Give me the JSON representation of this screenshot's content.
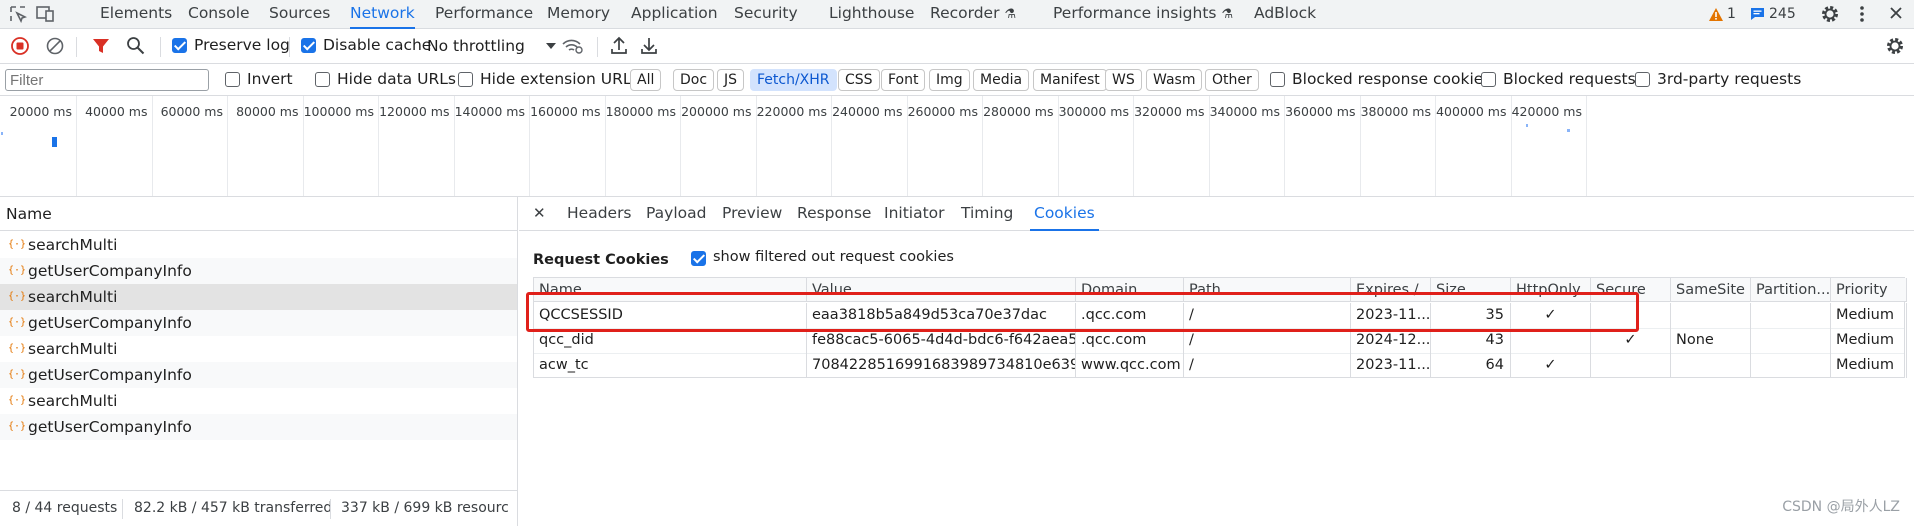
{
  "topbar": {
    "tabs": [
      "Elements",
      "Console",
      "Sources",
      "Network",
      "Performance",
      "Memory",
      "Application",
      "Security",
      "Lighthouse",
      "Recorder",
      "Performance insights",
      "AdBlock"
    ],
    "recorder_suffix": "⚗",
    "perf_insights_suffix": "⚗",
    "warning_count": "1",
    "message_count": "245"
  },
  "toolbar": {
    "preserve_log": "Preserve log",
    "disable_cache": "Disable cache",
    "throttling": "No throttling"
  },
  "filterbar": {
    "filter_placeholder": "Filter",
    "invert": "Invert",
    "hide_data_urls": "Hide data URLs",
    "hide_extension_urls": "Hide extension URLs",
    "types": [
      "All",
      "Doc",
      "JS",
      "Fetch/XHR",
      "CSS",
      "Font",
      "Img",
      "Media",
      "Manifest",
      "WS",
      "Wasm",
      "Other"
    ],
    "active_type": "Fetch/XHR",
    "blocked_response_cookies": "Blocked response cookies",
    "blocked_requests": "Blocked requests",
    "third_party": "3rd-party requests"
  },
  "overview": {
    "ticks": [
      "20000 ms",
      "40000 ms",
      "60000 ms",
      "80000 ms",
      "100000 ms",
      "120000 ms",
      "140000 ms",
      "160000 ms",
      "180000 ms",
      "200000 ms",
      "220000 ms",
      "240000 ms",
      "260000 ms",
      "280000 ms",
      "300000 ms",
      "320000 ms",
      "340000 ms",
      "360000 ms",
      "380000 ms",
      "400000 ms",
      "420000 ms"
    ]
  },
  "requests": {
    "header": "Name",
    "items": [
      "searchMulti",
      "getUserCompanyInfo",
      "searchMulti",
      "getUserCompanyInfo",
      "searchMulti",
      "getUserCompanyInfo",
      "searchMulti",
      "getUserCompanyInfo"
    ],
    "selected_index": 2,
    "xhr_glyph": "{·}"
  },
  "status": {
    "requests": "8 / 44 requests",
    "transferred": "82.2 kB / 457 kB transferred",
    "resources": "337 kB / 699 kB resources"
  },
  "detail": {
    "tabs": [
      "Headers",
      "Payload",
      "Preview",
      "Response",
      "Initiator",
      "Timing",
      "Cookies"
    ],
    "active_tab": "Cookies",
    "close_glyph": "✕",
    "section_title": "Request Cookies",
    "show_filtered": "show filtered out request cookies"
  },
  "cookies": {
    "columns": [
      "Name",
      "Value",
      "Domain",
      "Path",
      "Expires /...",
      "Size",
      "HttpOnly",
      "Secure",
      "SameSite",
      "Partition...",
      "Priority"
    ],
    "rows": [
      [
        "QCCSESSID",
        "eaa3818b5a849d53ca70e37dac",
        ".qcc.com",
        "/",
        "2023-11...",
        "35",
        "✓",
        "",
        "",
        "",
        "Medium"
      ],
      [
        "qcc_did",
        "fe88cac5-6065-4d4d-bdc6-f642aea5...",
        ".qcc.com",
        "/",
        "2024-12...",
        "43",
        "",
        "✓",
        "None",
        "",
        "Medium"
      ],
      [
        "acw_tc",
        "7084228516991683989734810e6396...",
        "www.qcc.com",
        "/",
        "2023-11...",
        "64",
        "✓",
        "",
        "",
        "",
        "Medium"
      ]
    ]
  },
  "watermark": "CSDN @局外人LZ",
  "colors": {
    "accent": "#1a73e8",
    "highlight": "#e0201a",
    "record": "#d93025"
  }
}
